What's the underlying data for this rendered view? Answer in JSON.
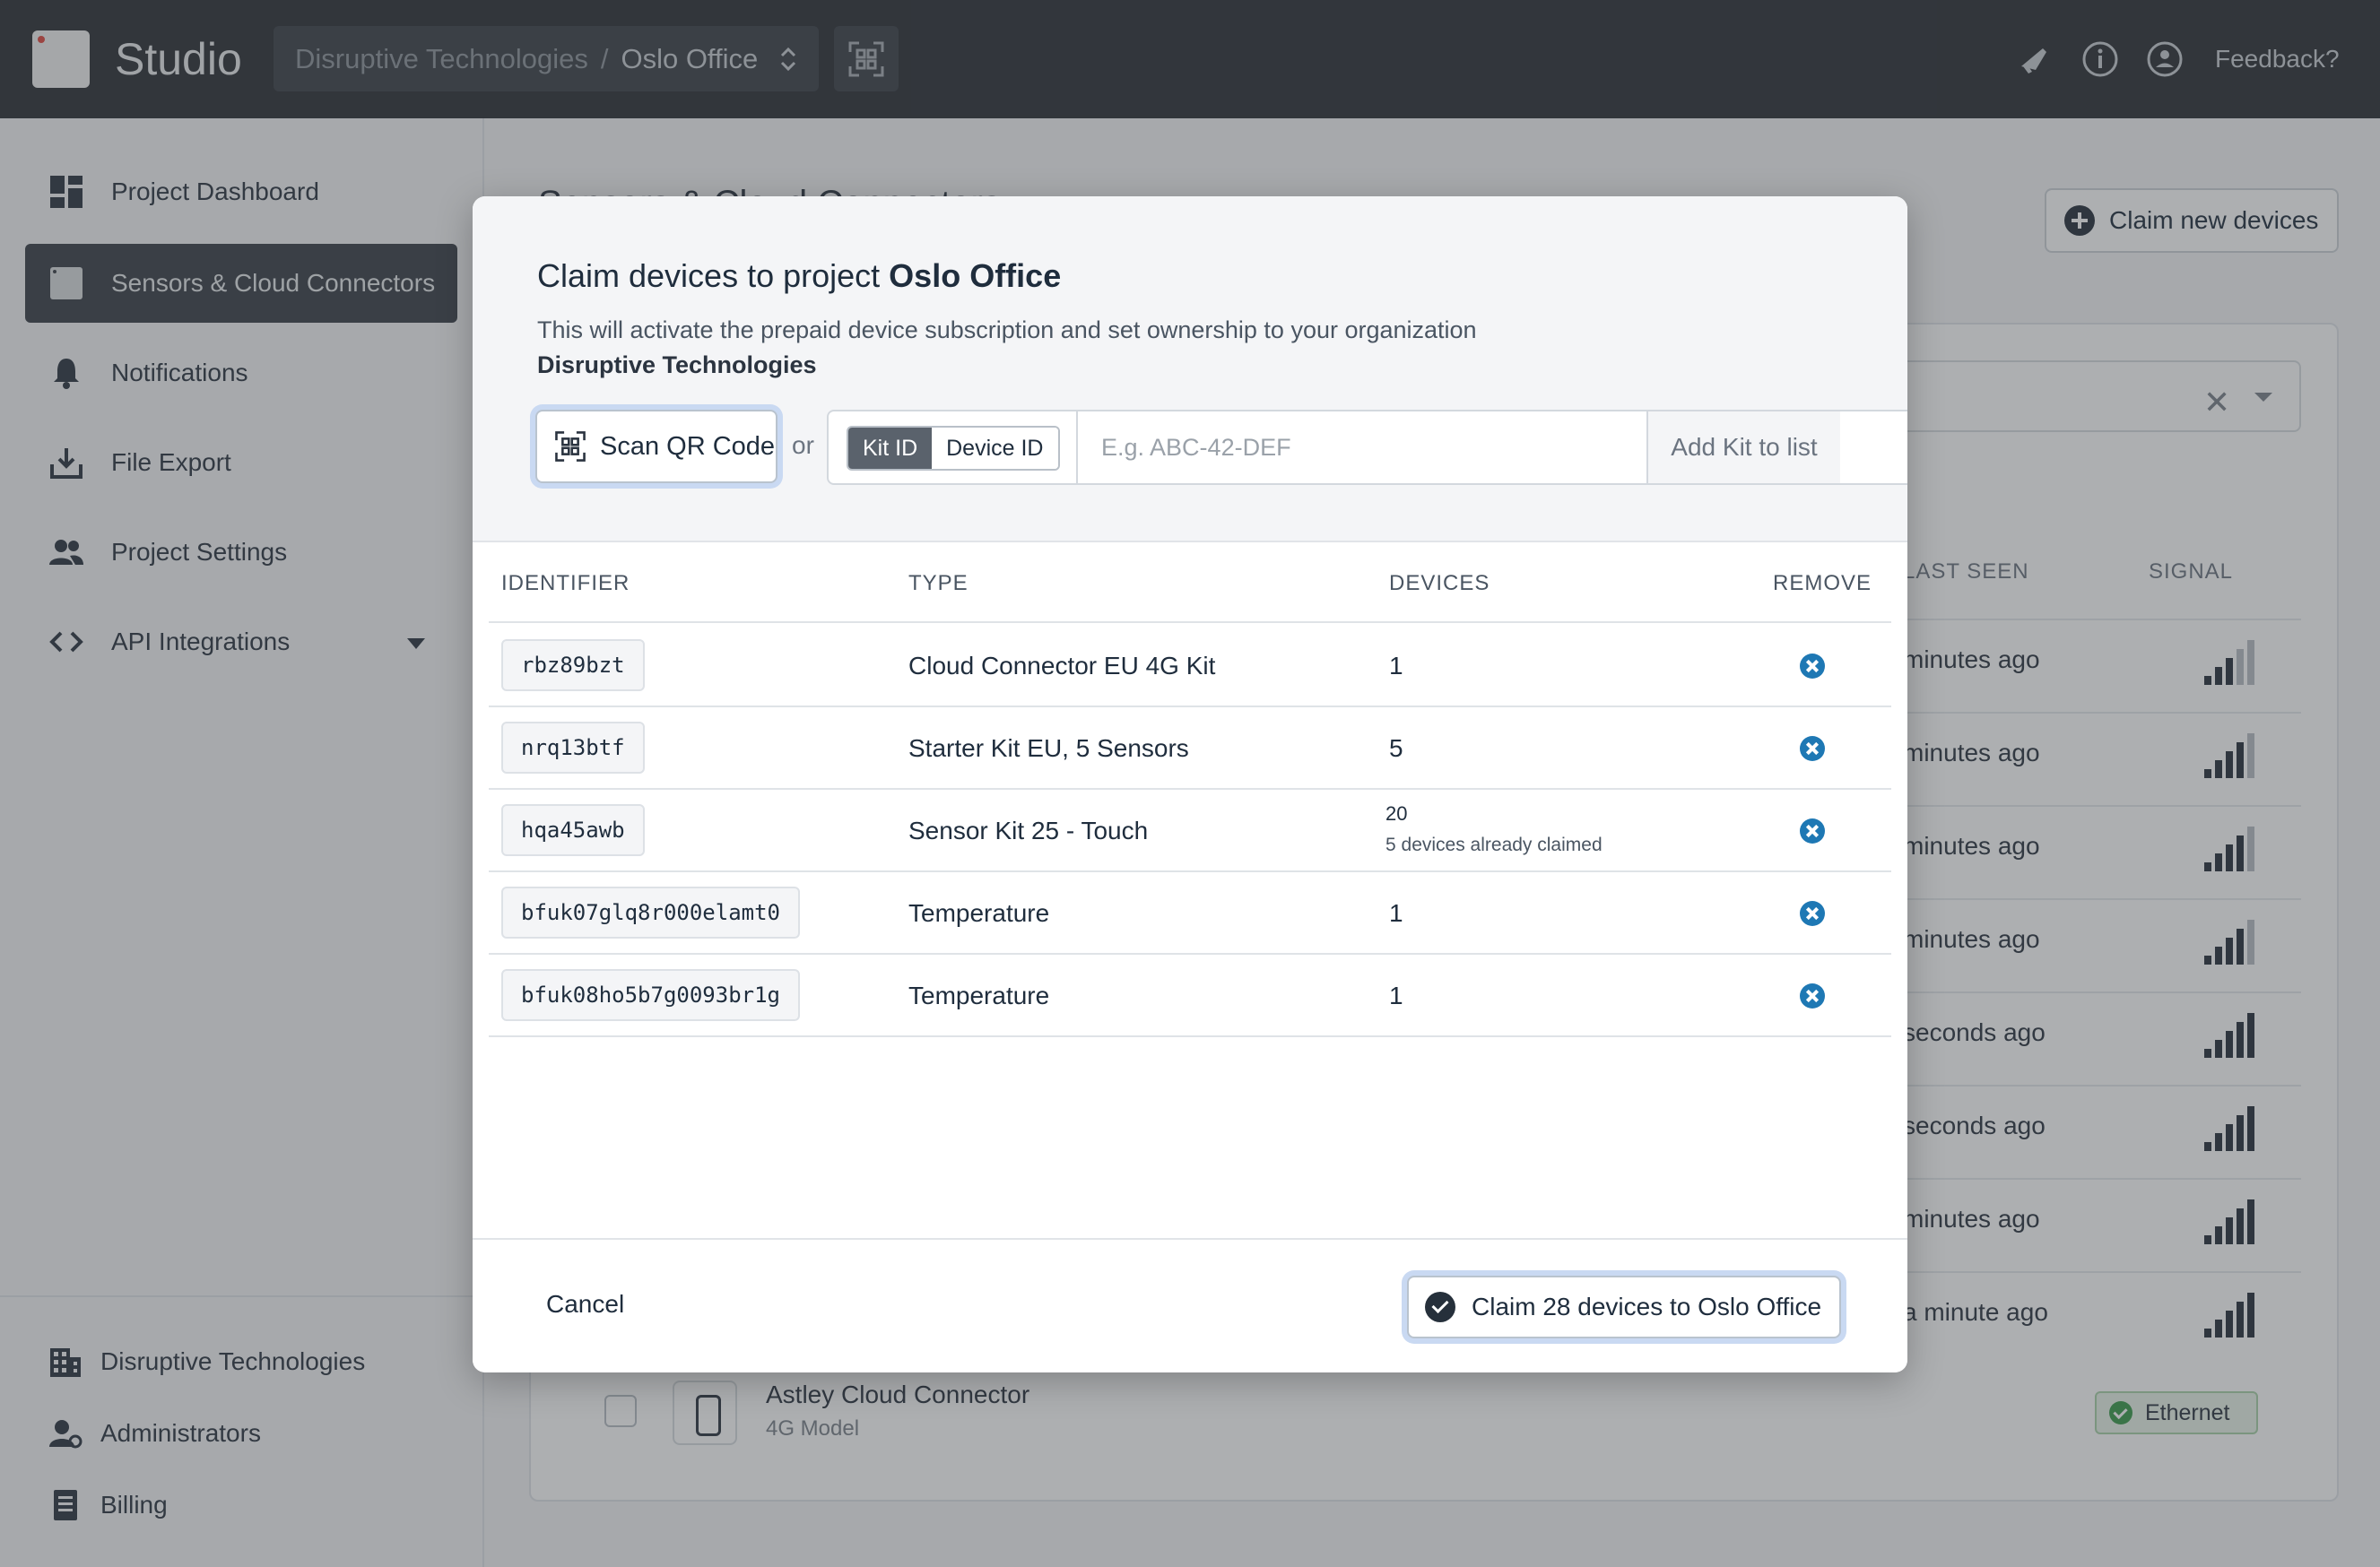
{
  "header": {
    "app_title": "Studio",
    "org": "Disruptive Technologies",
    "separator": "/",
    "project": "Oslo Office",
    "feedback": "Feedback?",
    "icons": [
      "qr-scan-icon",
      "megaphone-icon",
      "info-icon",
      "account-icon"
    ]
  },
  "sidebar": {
    "items": [
      {
        "label": "Project Dashboard",
        "icon": "dashboard-icon"
      },
      {
        "label": "Sensors & Cloud Connectors",
        "icon": "sensor-icon",
        "active": true
      },
      {
        "label": "Notifications",
        "icon": "bell-icon"
      },
      {
        "label": "File Export",
        "icon": "download-icon"
      },
      {
        "label": "Project Settings",
        "icon": "people-icon"
      },
      {
        "label": "API Integrations",
        "icon": "code-icon"
      }
    ],
    "org_items": [
      {
        "label": "Disruptive Technologies",
        "icon": "building-icon"
      },
      {
        "label": "Administrators",
        "icon": "admin-icon"
      },
      {
        "label": "Billing",
        "icon": "receipt-icon"
      }
    ]
  },
  "main": {
    "title": "Sensors & Cloud Connectors",
    "claim_new_label": "Claim new devices",
    "columns": {
      "last_seen": "LAST SEEN",
      "signal": "SIGNAL"
    },
    "last_seen_rows": [
      "minutes ago",
      "minutes ago",
      "minutes ago",
      "minutes ago",
      "seconds ago",
      "seconds ago",
      "minutes ago",
      "a minute ago"
    ],
    "signal_levels": [
      3,
      4,
      4,
      4,
      5,
      5,
      5,
      5
    ],
    "device": {
      "name": "Astley Cloud Connector",
      "model": "4G Model",
      "connection": "Ethernet"
    }
  },
  "modal": {
    "title_prefix": "Claim devices to project",
    "title_project": "Oslo Office",
    "description": "This will activate the prepaid device subscription and set ownership to your organization",
    "organization": "Disruptive Technologies",
    "scan_label": "Scan QR Code",
    "or_label": "or",
    "toggle": {
      "kit_id": "Kit ID",
      "device_id": "Device ID",
      "selected": "Kit ID"
    },
    "input_placeholder": "E.g. ABC-42-DEF",
    "input_value": "",
    "add_label": "Add Kit to list",
    "table": {
      "headers": {
        "identifier": "IDENTIFIER",
        "type": "TYPE",
        "devices": "DEVICES",
        "remove": "REMOVE"
      },
      "rows": [
        {
          "identifier": "rbz89bzt",
          "type": "Cloud Connector EU 4G Kit",
          "devices": "1",
          "note": ""
        },
        {
          "identifier": "nrq13btf",
          "type": "Starter Kit EU, 5 Sensors",
          "devices": "5",
          "note": ""
        },
        {
          "identifier": "hqa45awb",
          "type": "Sensor Kit 25 - Touch",
          "devices": "20",
          "note": "5 devices already claimed"
        },
        {
          "identifier": "bfuk07glq8r000elamt0",
          "type": "Temperature",
          "devices": "1",
          "note": ""
        },
        {
          "identifier": "bfuk08ho5b7g0093br1g",
          "type": "Temperature",
          "devices": "1",
          "note": ""
        }
      ]
    },
    "cancel_label": "Cancel",
    "claim_label": "Claim 28 devices to Oslo Office"
  },
  "colors": {
    "topbar": "#2b2f35",
    "active_nav": "#3a3f47",
    "remove_accent": "#1e78b4",
    "focus_ring": "#c9d9f2"
  }
}
